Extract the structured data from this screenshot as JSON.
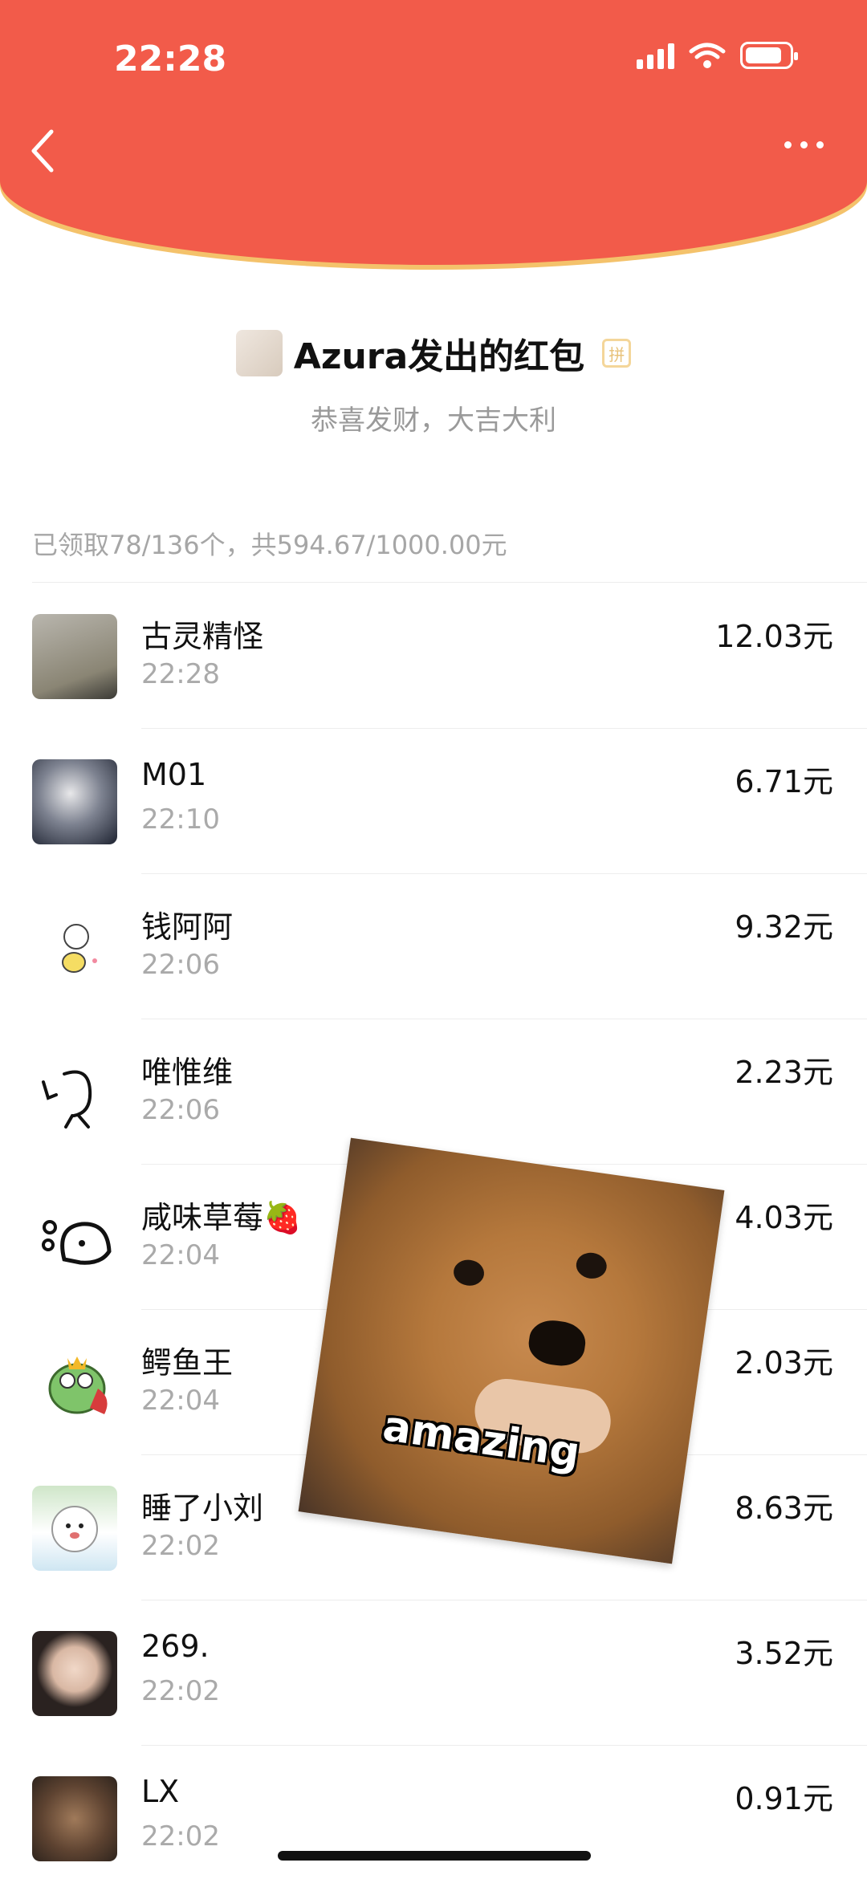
{
  "status_bar": {
    "time": "22:28"
  },
  "header": {
    "back_icon": "chevron-left-icon",
    "more_icon": "more-dots-icon"
  },
  "sender": {
    "title": "Azura发出的红包",
    "badge": "拼",
    "greeting": "恭喜发财，大吉大利"
  },
  "summary": "已领取78/136个，共594.67/1000.00元",
  "rows": [
    {
      "name": "古灵精怪",
      "time": "22:28",
      "amount": "12.03元"
    },
    {
      "name": "M01",
      "time": "22:10",
      "amount": "6.71元"
    },
    {
      "name": "钱阿阿",
      "time": "22:06",
      "amount": "9.32元"
    },
    {
      "name": "唯惟维",
      "time": "22:06",
      "amount": "2.23元"
    },
    {
      "name": "咸味草莓🍓",
      "time": "22:04",
      "amount": "4.03元"
    },
    {
      "name": "鳄鱼王",
      "time": "22:04",
      "amount": "2.03元"
    },
    {
      "name": "睡了小刘",
      "time": "22:02",
      "amount": "8.63元"
    },
    {
      "name": "269.",
      "time": "22:02",
      "amount": "3.52元"
    },
    {
      "name": "LX",
      "time": "22:02",
      "amount": "0.91元"
    }
  ],
  "sticker": {
    "caption": "amazing"
  },
  "colors": {
    "header_bg": "#f25b4a",
    "header_trim": "#f4c26b"
  }
}
